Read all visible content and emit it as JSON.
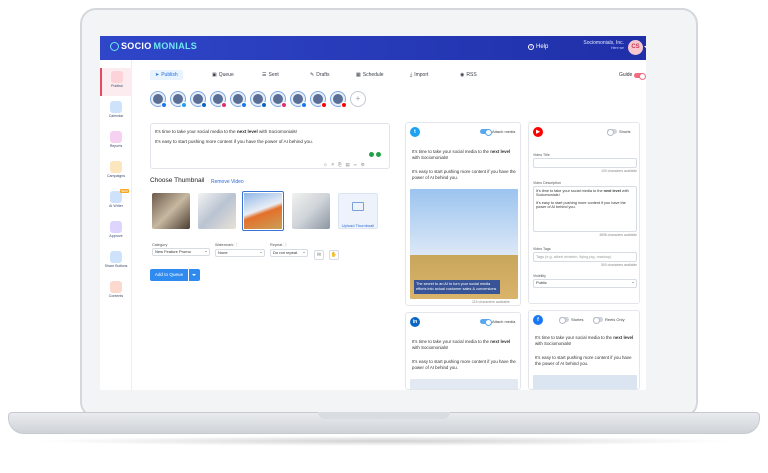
{
  "header": {
    "logo_main": "SOCIO",
    "logo_accent": "MONIALS",
    "help_label": "Help",
    "account_name": "Sociomonials, Inc.",
    "account_sub": "Here we",
    "avatar_initials": "CS"
  },
  "sidebar": {
    "items": [
      {
        "label": "Publish",
        "color": "#f26b6b",
        "active": true
      },
      {
        "label": "Calendar",
        "color": "#4a90e2"
      },
      {
        "label": "Reports",
        "color": "#e86fd6"
      },
      {
        "label": "Campaigns",
        "color": "#f5a623"
      },
      {
        "label": "AI Writer",
        "color": "#4a90e2",
        "badge": "NEW"
      },
      {
        "label": "Approve",
        "color": "#7b61ff"
      },
      {
        "label": "Share Buttons",
        "color": "#4a90e2"
      },
      {
        "label": "Contents",
        "color": "#f0876a"
      }
    ]
  },
  "tabs": [
    {
      "label": "Publish",
      "icon": "send-icon",
      "active": true
    },
    {
      "label": "Queue",
      "icon": "queue-icon"
    },
    {
      "label": "Sent",
      "icon": "sent-icon"
    },
    {
      "label": "Drafts",
      "icon": "drafts-icon"
    },
    {
      "label": "Schedule",
      "icon": "calendar-icon"
    },
    {
      "label": "Import",
      "icon": "import-icon"
    },
    {
      "label": "RSS",
      "icon": "rss-icon"
    }
  ],
  "guide_label": "Guide",
  "accounts": [
    {
      "badge_color": "#1877f2"
    },
    {
      "badge_color": "#1da1f2"
    },
    {
      "badge_color": "#0a66c2"
    },
    {
      "badge_color": "#e1306c"
    },
    {
      "badge_color": "#1877f2"
    },
    {
      "badge_color": "#0a66c2"
    },
    {
      "badge_color": "#e1306c"
    },
    {
      "badge_color": "#1877f2"
    },
    {
      "badge_color": "#ff0000"
    },
    {
      "badge_color": "#ff0000"
    }
  ],
  "composer": {
    "line1_pre": "It's time to take your social media to the ",
    "line1_bold": "next level",
    "line1_post": " with Sociomonials!",
    "line2": "It's easy to start pushing more content if you have the power of AI behind you."
  },
  "thumbnail": {
    "title": "Choose Thumbnail",
    "remove_label": "Remove Video",
    "upload_label": "Upload Thumbnail"
  },
  "fields": {
    "category_label": "Category",
    "category_value": "New Feature Promo",
    "watermark_label": "Watermark",
    "watermark_value": "None",
    "repeat_label": "Repeat",
    "repeat_value": "Do not repeat"
  },
  "add_queue_label": "Add to Queue",
  "previews": {
    "twitter": {
      "attach_label": "Attach media",
      "text1_pre": "It's time to take your social media to the ",
      "text1_bold": "next level",
      "text1_post": " with Sociomonials!",
      "text2": "It's easy to start pushing more content if you have the power of AI behind you.",
      "image_caption": "The secret to an AI to turn your social media efforts into actual customer sales & conversions",
      "count": "115 characters available"
    },
    "linkedin": {
      "attach_label": "Attach media",
      "text1_pre": "It's time to take your social media to the ",
      "text1_bold": "next level",
      "text1_post": " with Sociomonials!",
      "text2": "It's easy to start pushing more content if you have the power of AI behind you."
    },
    "youtube": {
      "shorts_label": "Shorts",
      "title_label": "Video Title",
      "title_count": "100 characters available",
      "desc_label": "Video Description",
      "desc_pre": "It's time to take your social media to the ",
      "desc_bold": "next level",
      "desc_post": " with Sociomonials!",
      "desc2": "It's easy to start pushing more content if you have the power of AI behind you.",
      "desc_count": "4898 characters available",
      "tags_label": "Video Tags",
      "tags_placeholder": "Tags (e.g. albert einstein, flying pig, mashup)",
      "tags_count": "500 characters available",
      "visibility_label": "Visibility",
      "visibility_value": "Public"
    },
    "facebook": {
      "stories_label": "Stories",
      "reels_label": "Reels Only",
      "text1_pre": "It's time to take your social media to the ",
      "text1_bold": "next level",
      "text1_post": " with Sociomonials!",
      "text2": "It's easy to start pushing more content if you have the power of AI behind you."
    }
  }
}
